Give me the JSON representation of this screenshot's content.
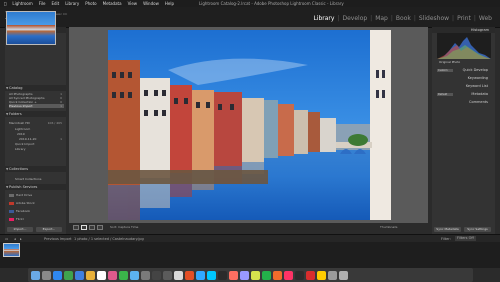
{
  "menubar": {
    "apple": "",
    "items": [
      "Lightroom",
      "File",
      "Edit",
      "Library",
      "Photo",
      "Metadata",
      "View",
      "Window",
      "Help"
    ],
    "window_title": "Lightroom Catalog-2.lrcat - Adobe Photoshop Lightroom Classic - Library"
  },
  "identity": {
    "logo": "Lr",
    "account_small": "Adobe Lightroom Classic CC",
    "account_name": "David Hyne"
  },
  "modules": {
    "items": [
      "Library",
      "Develop",
      "Map",
      "Book",
      "Slideshow",
      "Print",
      "Web"
    ],
    "active": "Library"
  },
  "left_panel": {
    "navigator": {
      "title": "Navigator",
      "options": "FIT  FILL  1:1  3:1"
    },
    "catalog": {
      "title": "Catalog",
      "rows": [
        {
          "label": "All Photographs",
          "count": "1"
        },
        {
          "label": "All Synced Photographs",
          "count": "0"
        },
        {
          "label": "Quick Collection +",
          "count": "0"
        },
        {
          "label": "Previous Import",
          "count": "1"
        }
      ]
    },
    "folders": {
      "title": "Folders",
      "rows": [
        {
          "label": "Macintosh HD",
          "count": "106 / 465"
        },
        {
          "label": "Lightroom",
          "count": ""
        },
        {
          "label": "2019",
          "count": ""
        },
        {
          "label": "2019-11-20",
          "count": "1"
        },
        {
          "label": "Quick Import",
          "count": ""
        },
        {
          "label": "Library",
          "count": ""
        }
      ]
    },
    "collections": {
      "title": "Collections",
      "rows": [
        {
          "label": "Smart Collections",
          "count": ""
        }
      ]
    },
    "publish_services": {
      "title": "Publish Services",
      "rows": [
        {
          "label": "Hard Drive",
          "count": "",
          "color": "#6b6b6b"
        },
        {
          "label": "Adobe Stock",
          "count": "",
          "color": "#c0392b"
        },
        {
          "label": "Facebook",
          "count": "",
          "color": "#3b5998"
        },
        {
          "label": "Flickr",
          "count": "",
          "color": "#e91e63"
        }
      ]
    },
    "import_label": "Import...",
    "export_label": "Export..."
  },
  "toolbar": {
    "sort_label": "Sort: Capture Time",
    "thumbnails_label": "Thumbnails"
  },
  "right_panel": {
    "histogram_title": "Histogram",
    "orig_label": "Original Photo",
    "rows": [
      {
        "label": "Quick Develop",
        "dropdown": "Custom"
      },
      {
        "label": "Keywording",
        "dropdown": ""
      },
      {
        "label": "Keyword List",
        "dropdown": ""
      },
      {
        "label": "Metadata",
        "dropdown": "Default"
      },
      {
        "label": "Comments",
        "dropdown": ""
      }
    ],
    "sync_metadata": "Sync Metadata",
    "sync_settings": "Sync Settings"
  },
  "filmstrip": {
    "source": "Previous Import",
    "info": "1 photo / 1 selected / Castelnaudary.jpg",
    "filter_label": "Filter:",
    "filter_value": "Filters Off"
  },
  "colors": {
    "menubar_bg": "#1d1d1d",
    "panel_bg": "#333333",
    "center_bg": "#5a5a5a",
    "active_module": "#ffffff"
  }
}
